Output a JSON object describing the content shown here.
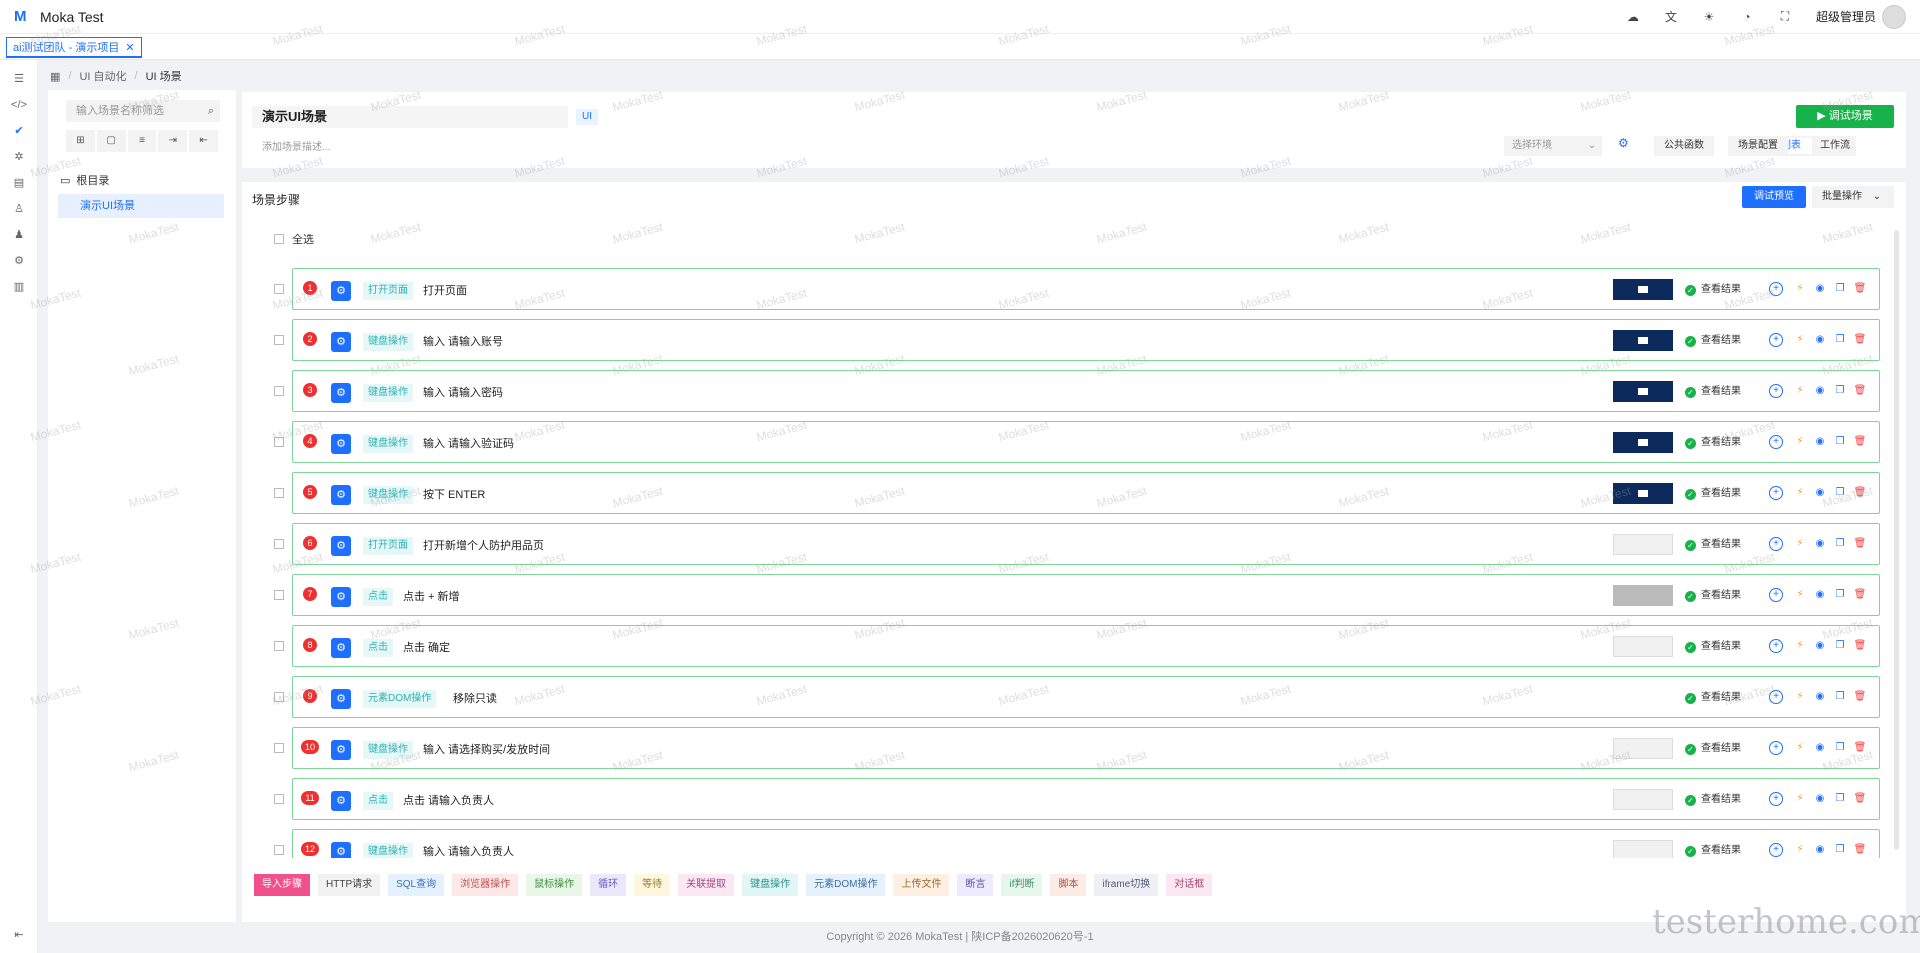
{
  "app": {
    "title": "Moka Test"
  },
  "header": {
    "user_name": "超级管理员"
  },
  "tabs": [
    {
      "label": "ai测试团队 - 演示项目"
    }
  ],
  "breadcrumb": [
    "UI 自动化",
    "UI 场景"
  ],
  "tree": {
    "search_placeholder": "输入场景名称筛选",
    "root_label": "根目录",
    "items": [
      {
        "label": "演示UI场景"
      }
    ]
  },
  "scene": {
    "title": "演示UI场景",
    "tag": "UI",
    "desc_placeholder": "添加场景描述...",
    "debug_button": "调试场景",
    "env_placeholder": "选择环境",
    "public_funcs": "公共函数",
    "scene_config": "场景配置",
    "view_list": "列表",
    "view_flow": "工作流"
  },
  "steps_panel": {
    "title": "场景步骤",
    "preview_button": "调试预览",
    "batch_button": "批量操作",
    "select_all": "全选",
    "result_label": "查看结果"
  },
  "steps": [
    {
      "num": "1",
      "type": "打开页面",
      "desc": "打开页面",
      "shot": "dark"
    },
    {
      "num": "2",
      "type": "键盘操作",
      "desc": "输入 请输入账号",
      "shot": "dark"
    },
    {
      "num": "3",
      "type": "键盘操作",
      "desc": "输入 请输入密码",
      "shot": "dark"
    },
    {
      "num": "4",
      "type": "键盘操作",
      "desc": "输入 请输入验证码",
      "shot": "dark"
    },
    {
      "num": "5",
      "type": "键盘操作",
      "desc": "按下 ENTER",
      "shot": "dark"
    },
    {
      "num": "6",
      "type": "打开页面",
      "desc": "打开新增个人防护用品页",
      "shot": "light"
    },
    {
      "num": "7",
      "type": "点击",
      "desc": "点击 + 新增",
      "shot": "gray"
    },
    {
      "num": "8",
      "type": "点击",
      "desc": "点击 确定",
      "shot": "light"
    },
    {
      "num": "9",
      "type": "元素DOM操作",
      "desc": "移除只读",
      "shot": "none"
    },
    {
      "num": "10",
      "type": "键盘操作",
      "desc": "输入 请选择购买/发放时间",
      "shot": "light"
    },
    {
      "num": "11",
      "type": "点击",
      "desc": "点击 请输入负责人",
      "shot": "light"
    },
    {
      "num": "12",
      "type": "键盘操作",
      "desc": "输入 请输入负责人",
      "shot": "light"
    }
  ],
  "toolbar": [
    {
      "label": "导入步骤",
      "color": "#f0508c",
      "bg": "#f0508c",
      "fg": "#ffffff"
    },
    {
      "label": "HTTP请求",
      "bg": "#f2f2f2",
      "fg": "#444444"
    },
    {
      "label": "SQL查询",
      "bg": "#e4f1ff",
      "fg": "#3b6fb6"
    },
    {
      "label": "浏览器操作",
      "bg": "#fde8e8",
      "fg": "#c0504d"
    },
    {
      "label": "鼠标操作",
      "bg": "#e8f7e8",
      "fg": "#3c8d3c"
    },
    {
      "label": "循环",
      "bg": "#ece8fb",
      "fg": "#6a55c4"
    },
    {
      "label": "等待",
      "bg": "#fff6e0",
      "fg": "#9a7a20"
    },
    {
      "label": "关联提取",
      "bg": "#fbe8f4",
      "fg": "#a0487a"
    },
    {
      "label": "键盘操作",
      "bg": "#e3f6f6",
      "fg": "#2c8f8f"
    },
    {
      "label": "元素DOM操作",
      "bg": "#e6f1fb",
      "fg": "#3a6fa0"
    },
    {
      "label": "上传文件",
      "bg": "#fdf0e3",
      "fg": "#9a6a30"
    },
    {
      "label": "断言",
      "bg": "#eeeaff",
      "fg": "#5a50a0"
    },
    {
      "label": "if判断",
      "bg": "#e8f7ee",
      "fg": "#3c8d5c"
    },
    {
      "label": "脚本",
      "bg": "#fdebe6",
      "fg": "#a05a40"
    },
    {
      "label": "iframe切换",
      "bg": "#eef0f6",
      "fg": "#505a70"
    },
    {
      "label": "对话框",
      "bg": "#fbe8f0",
      "fg": "#a04870"
    }
  ],
  "footer": {
    "text": "Copyright © 2026 MokaTest | 陕ICP备2026020620号-1"
  },
  "watermark": {
    "text": "MokaTest"
  },
  "corner_watermark": {
    "text": "testerhome.com"
  },
  "colors": {
    "primary": "#1e6fff",
    "success": "#18b24a",
    "danger": "#f03030"
  }
}
